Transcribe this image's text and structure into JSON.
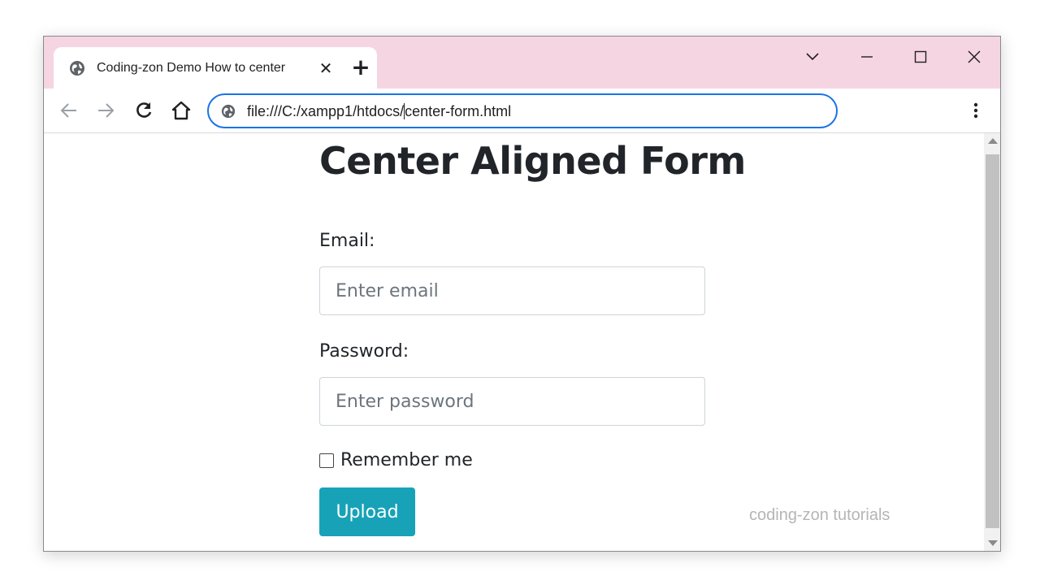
{
  "browser": {
    "tab": {
      "title": "Coding-zon Demo How to center",
      "close_label": "✕",
      "globe_icon": "globe-icon"
    },
    "new_tab_label": "+",
    "window_controls": [
      "chevron-down-icon",
      "minimize-icon",
      "maximize-icon",
      "close-icon"
    ],
    "nav": [
      "back-arrow-icon",
      "forward-arrow-icon",
      "reload-icon",
      "home-icon"
    ],
    "address": {
      "url_before_caret": "file:///C:/xampp1/htdocs/",
      "url_after_caret": "center-form.html"
    },
    "menu_icon": "vertical-dots-icon",
    "colors": {
      "titlebar": "#f6d5e3",
      "omnibox_border": "#1a73e8"
    }
  },
  "page": {
    "title": "Center Aligned Form",
    "form": {
      "email_label": "Email:",
      "email_placeholder": "Enter email",
      "email_value": "",
      "password_label": "Password:",
      "password_placeholder": "Enter password",
      "password_value": "",
      "remember_label": "Remember me",
      "remember_checked": false,
      "submit_label": "Upload"
    },
    "watermark": "coding-zon tutorials",
    "colors": {
      "button": "#17a2b8",
      "text": "#212529"
    }
  }
}
